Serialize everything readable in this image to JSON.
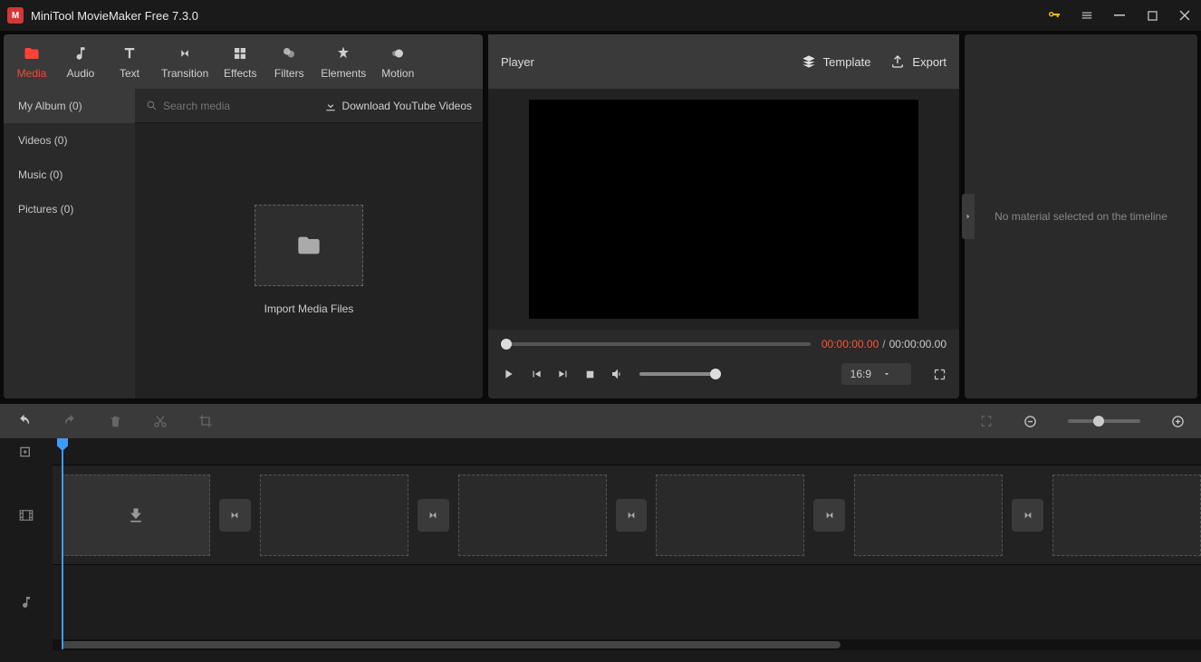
{
  "app": {
    "title": "MiniTool MovieMaker Free 7.3.0"
  },
  "toolbar": {
    "media": "Media",
    "audio": "Audio",
    "text": "Text",
    "transition": "Transition",
    "effects": "Effects",
    "filters": "Filters",
    "elements": "Elements",
    "motion": "Motion"
  },
  "media": {
    "categories": {
      "album": "My Album (0)",
      "videos": "Videos (0)",
      "music": "Music (0)",
      "pictures": "Pictures (0)"
    },
    "search_placeholder": "Search media",
    "download_label": "Download YouTube Videos",
    "import_label": "Import Media Files"
  },
  "player": {
    "title": "Player",
    "template": "Template",
    "export": "Export",
    "time_current": "00:00:00.00",
    "time_separator": "/",
    "time_total": "00:00:00.00",
    "aspect": "16:9"
  },
  "inspector": {
    "empty": "No material selected on the timeline"
  }
}
